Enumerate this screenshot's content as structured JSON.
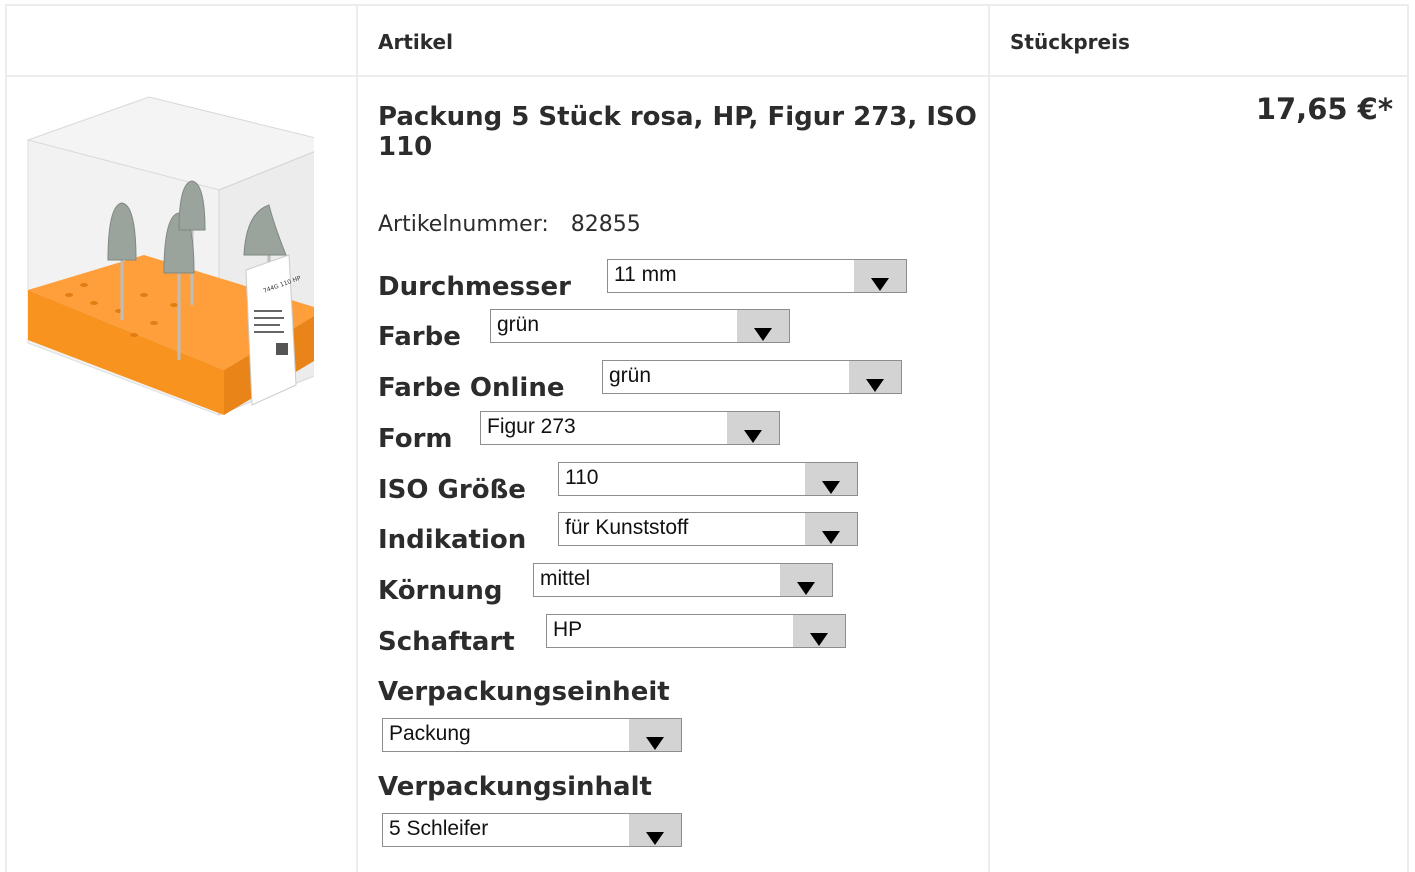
{
  "header": {
    "col_article": "Artikel",
    "col_price": "Stückpreis"
  },
  "product": {
    "title": "Packung 5 Stück rosa, HP, Figur 273, ISO 110",
    "article_number_label": "Artikelnummer:",
    "article_number": "82855",
    "price": "17,65 €*",
    "image_label_code": "744G 110 HP",
    "options": [
      {
        "label": "Durchmesser",
        "value": "11 mm"
      },
      {
        "label": "Farbe",
        "value": "grün"
      },
      {
        "label": "Farbe Online",
        "value": "grün"
      },
      {
        "label": "Form",
        "value": "Figur 273"
      },
      {
        "label": "ISO Größe",
        "value": "110"
      },
      {
        "label": "Indikation",
        "value": "für Kunststoff"
      },
      {
        "label": "Körnung",
        "value": "mittel"
      },
      {
        "label": "Schaftart",
        "value": "HP"
      },
      {
        "label": "Verpackungseinheit",
        "value": "Packung"
      },
      {
        "label": "Verpackungsinhalt",
        "value": "5 Schleifer"
      }
    ]
  },
  "colors": {
    "border": "#ececec",
    "text": "#2c2c2c",
    "box_orange": "#f7931e",
    "select_arrow_bg": "#d3d3d3"
  }
}
